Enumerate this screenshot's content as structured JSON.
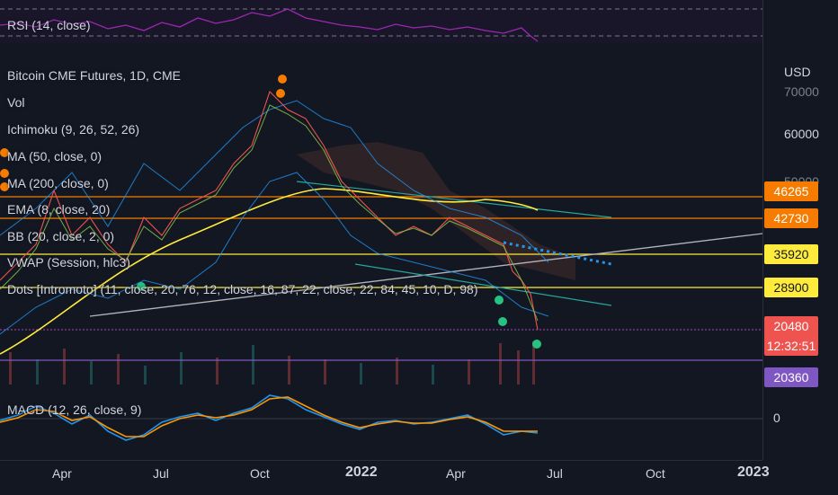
{
  "rsi": {
    "label": "RSI (14, close)"
  },
  "chart": {
    "title": "Bitcoin CME Futures, 1D, CME",
    "indicators": [
      "Vol",
      "Ichimoku (9, 26, 52, 26)",
      "MA (50, close, 0)",
      "MA (200, close, 0)",
      "EMA (8, close, 20)",
      "BB (20, close, 2, 0)",
      "VWAP (Session, hlc3)",
      "Dots [Intromoto] (11, close, 20, 76, 12, close, 16, 87, 22, close, 22, 84, 45, 10, D, 98)"
    ]
  },
  "macd": {
    "label": "MACD (12, 26, close, 9)",
    "zero": "0"
  },
  "price_axis": {
    "currency": "USD",
    "ticks": [
      "70000",
      "60000",
      "50000"
    ],
    "tags": [
      {
        "value": "46265",
        "bg": "#f57c00",
        "fg": "#ffffff"
      },
      {
        "value": "42730",
        "bg": "#f57c00",
        "fg": "#ffffff"
      },
      {
        "value": "35920",
        "bg": "#ffeb3b",
        "fg": "#131722"
      },
      {
        "value": "28900",
        "bg": "#ffeb3b",
        "fg": "#131722"
      },
      {
        "value": "20480",
        "bg": "#ef5350",
        "fg": "#ffffff"
      },
      {
        "value": "12:32:51",
        "bg": "#ef5350",
        "fg": "#ffffff"
      },
      {
        "value": "20360",
        "bg": "#7e57c2",
        "fg": "#ffffff"
      }
    ]
  },
  "time_axis": {
    "labels": [
      "Apr",
      "Jul",
      "Oct",
      "2022",
      "Apr",
      "Jul",
      "Oct",
      "2023"
    ]
  },
  "colors": {
    "background": "#131722",
    "orange_level": "#f57c00",
    "yellow_level": "#ffeb3b",
    "purple_level": "#7e57c2",
    "rsi": "#9c27b0",
    "macd": "#2196f3",
    "signal": "#ff9800"
  }
}
